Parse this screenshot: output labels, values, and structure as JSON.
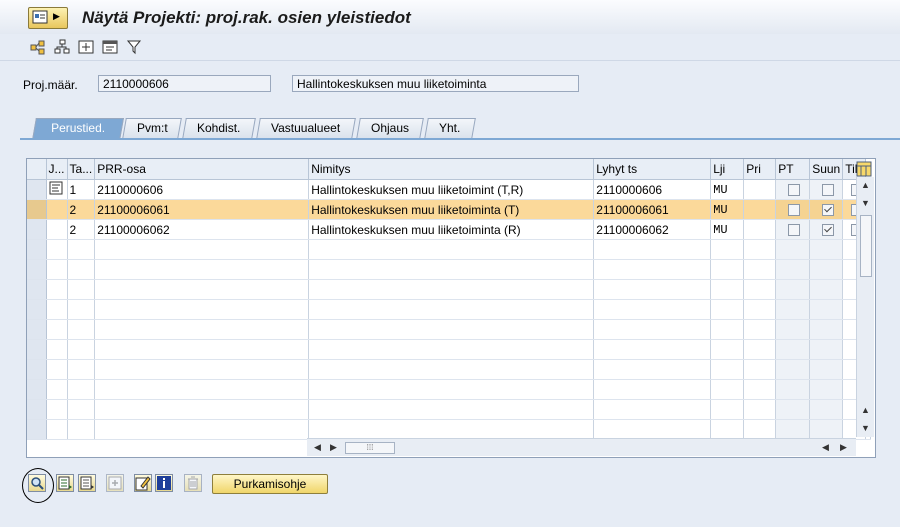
{
  "window": {
    "title": "Näytä Projekti: proj.rak. osien yleistiedot"
  },
  "app_toolbar": {
    "icons": [
      "hierarchy-icon",
      "structure-icon",
      "expand-icon",
      "header-icon",
      "filter-icon"
    ]
  },
  "header": {
    "project_label": "Proj.määr.",
    "project_value": "2110000606",
    "project_desc": "Hallintokeskuksen muu liiketoiminta"
  },
  "tabs": [
    {
      "label": "Perustied.",
      "active": true
    },
    {
      "label": "Pvm:t",
      "active": false
    },
    {
      "label": "Kohdist.",
      "active": false
    },
    {
      "label": "Vastuualueet",
      "active": false
    },
    {
      "label": "Ohjaus",
      "active": false
    },
    {
      "label": "Yht.",
      "active": false
    }
  ],
  "table": {
    "columns": [
      "J...",
      "Ta...",
      "PRR-osa",
      "Nimitys",
      "Lyhyt ts",
      "Lji",
      "Pri",
      "PT",
      "Suun",
      "Til"
    ],
    "rows": [
      {
        "j": "",
        "ta": "1",
        "prr": "2110000606",
        "nimitys": "Hallintokeskuksen muu liiketoimint (T,R)",
        "lyhyt": "2110000606",
        "lji": "MU",
        "pri": "",
        "pt": false,
        "suun": false,
        "highlighted": false
      },
      {
        "j": "",
        "ta": "2",
        "prr": "21100006061",
        "nimitys": "Hallintokeskuksen muu liiketoiminta (T)",
        "lyhyt": "21100006061",
        "lji": "MU",
        "pri": "",
        "pt": false,
        "suun": true,
        "highlighted": true
      },
      {
        "j": "",
        "ta": "2",
        "prr": "21100006062",
        "nimitys": "Hallintokeskuksen muu liiketoiminta (R)",
        "lyhyt": "21100006062",
        "lji": "MU",
        "pri": "",
        "pt": false,
        "suun": true,
        "highlighted": false
      }
    ],
    "empty_rows": 10
  },
  "bottom_toolbar": {
    "purkamisohje_label": "Purkamisohje"
  },
  "colors": {
    "background": "#e6ecf5",
    "active_tab": "#7ea8d4",
    "row_highlight": "#fbd99a",
    "button_yellow": "#f0d56a"
  }
}
